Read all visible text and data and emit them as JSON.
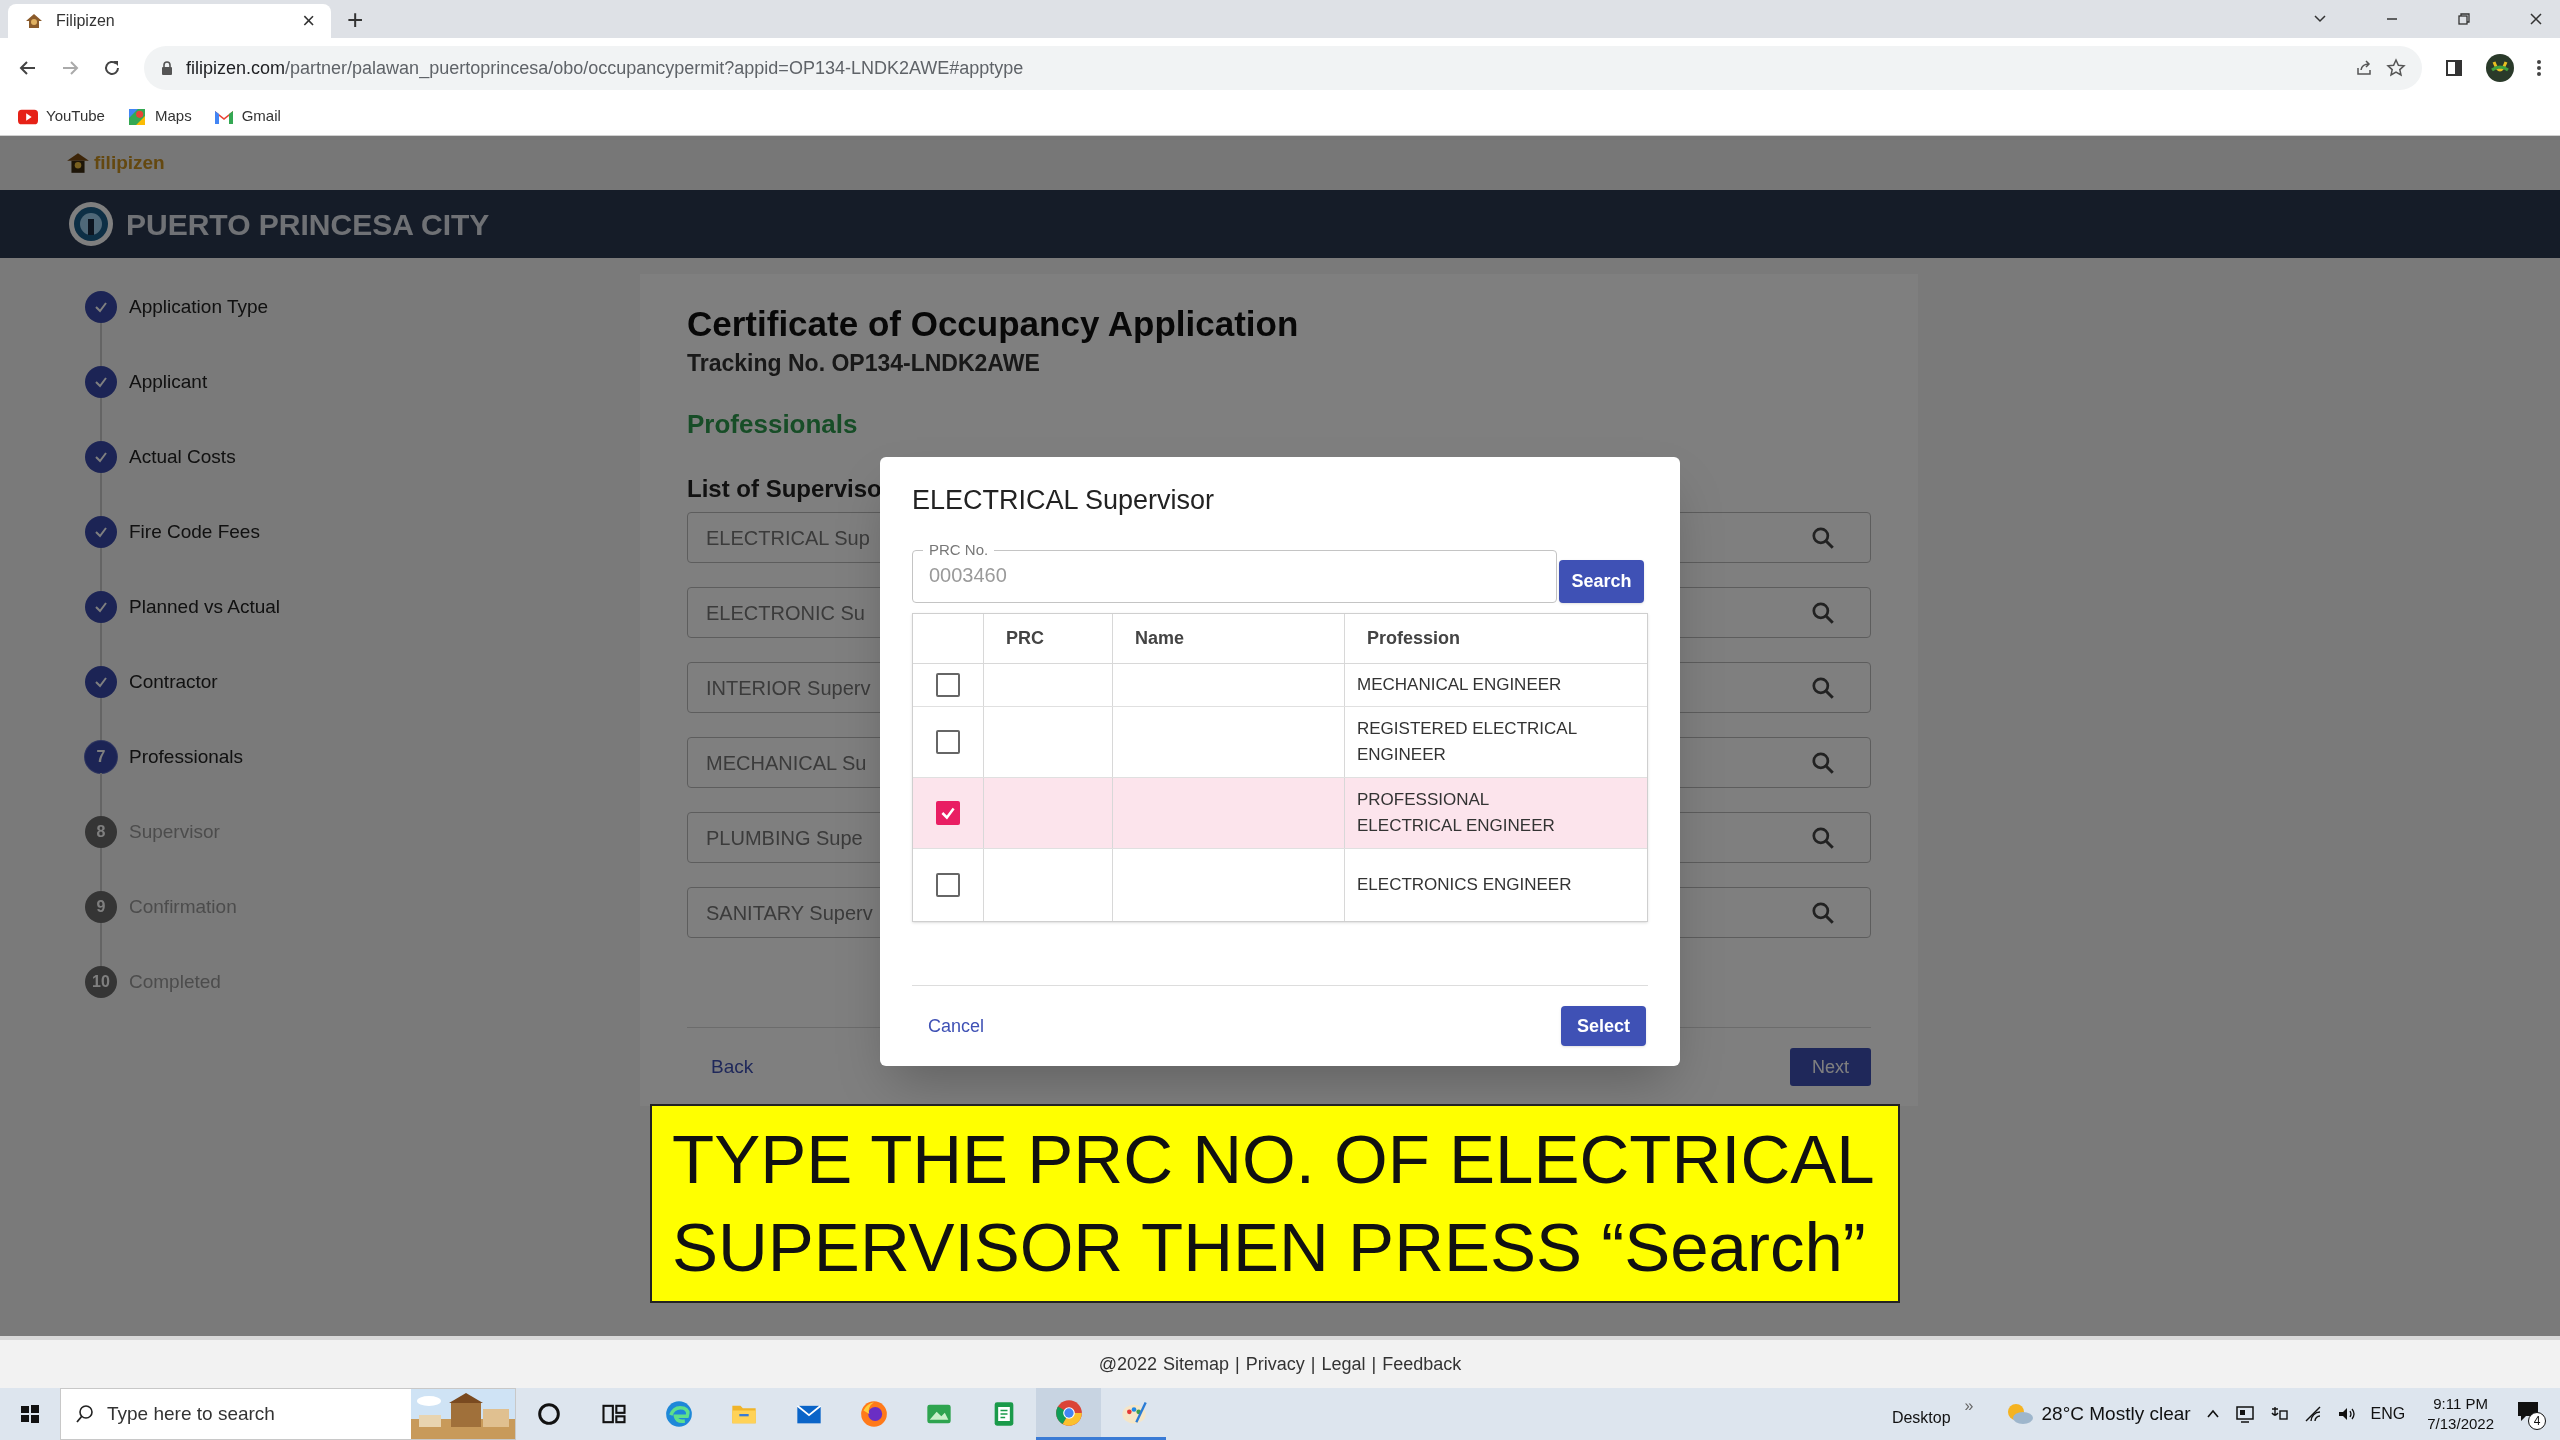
{
  "browser": {
    "tab_title": "Filipizen",
    "tab_close": "×",
    "new_tab": "+",
    "url_domain": "filipizen.com",
    "url_path": "/partner/palawan_puertoprincesa/obo/occupancypermit?appid=OP134-LNDK2AWE#apptype",
    "bookmarks": [
      {
        "label": "YouTube",
        "kind": "youtube"
      },
      {
        "label": "Maps",
        "kind": "maps"
      },
      {
        "label": "Gmail",
        "kind": "gmail"
      }
    ]
  },
  "site": {
    "brand": "filipizen",
    "city": "PUERTO PRINCESA CITY"
  },
  "steps": [
    {
      "label": "Application Type",
      "completed": true,
      "current": false
    },
    {
      "label": "Applicant",
      "completed": true,
      "current": false
    },
    {
      "label": "Actual Costs",
      "completed": true,
      "current": false
    },
    {
      "label": "Fire Code Fees",
      "completed": true,
      "current": false
    },
    {
      "label": "Planned vs Actual",
      "completed": true,
      "current": false
    },
    {
      "label": "Contractor",
      "completed": true,
      "current": false
    },
    {
      "label": "Professionals",
      "completed": false,
      "current": true,
      "number": "7"
    },
    {
      "label": "Supervisor",
      "completed": false,
      "current": false,
      "number": "8"
    },
    {
      "label": "Confirmation",
      "completed": false,
      "current": false,
      "number": "9"
    },
    {
      "label": "Completed",
      "completed": false,
      "current": false,
      "number": "10"
    }
  ],
  "main": {
    "title": "Certificate of Occupancy Application",
    "tracking": "Tracking No. OP134-LNDK2AWE",
    "section": "Professionals",
    "list_title": "List of Superviso",
    "supervisors": [
      "ELECTRICAL Sup",
      "ELECTRONIC Su",
      "INTERIOR Superv",
      "MECHANICAL Su",
      "PLUMBING Supe",
      "SANITARY Superv"
    ],
    "back": "Back",
    "next": "Next"
  },
  "dialog": {
    "title": "ELECTRICAL Supervisor",
    "prc_label": "PRC No.",
    "prc_placeholder": "0003460",
    "search_button": "Search",
    "table": {
      "columns": [
        "PRC",
        "Name",
        "Profession"
      ],
      "rows": [
        {
          "profession": "MECHANICAL ENGINEER",
          "selected": false
        },
        {
          "profession": "REGISTERED ELECTRICAL ENGINEER",
          "selected": false
        },
        {
          "profession": "PROFESSIONAL ELECTRICAL ENGINEER",
          "selected": true
        },
        {
          "profession": "ELECTRONICS ENGINEER",
          "selected": false
        }
      ]
    },
    "cancel": "Cancel",
    "select": "Select"
  },
  "caption_lines": [
    "TYPE THE PRC NO. OF ELECTRICAL",
    "SUPERVISOR THEN PRESS “Search”"
  ],
  "footer": {
    "copyright": "@2022",
    "links": [
      "Sitemap",
      "Privacy",
      "Legal",
      "Feedback"
    ],
    "separator": "|"
  },
  "taskbar": {
    "search_placeholder": "Type here to search",
    "desktop": "Desktop",
    "chevron": "»",
    "weather": "28°C Mostly clear",
    "language": "ENG",
    "time": "9:11 PM",
    "date": "7/13/2022",
    "notifications": "4"
  }
}
